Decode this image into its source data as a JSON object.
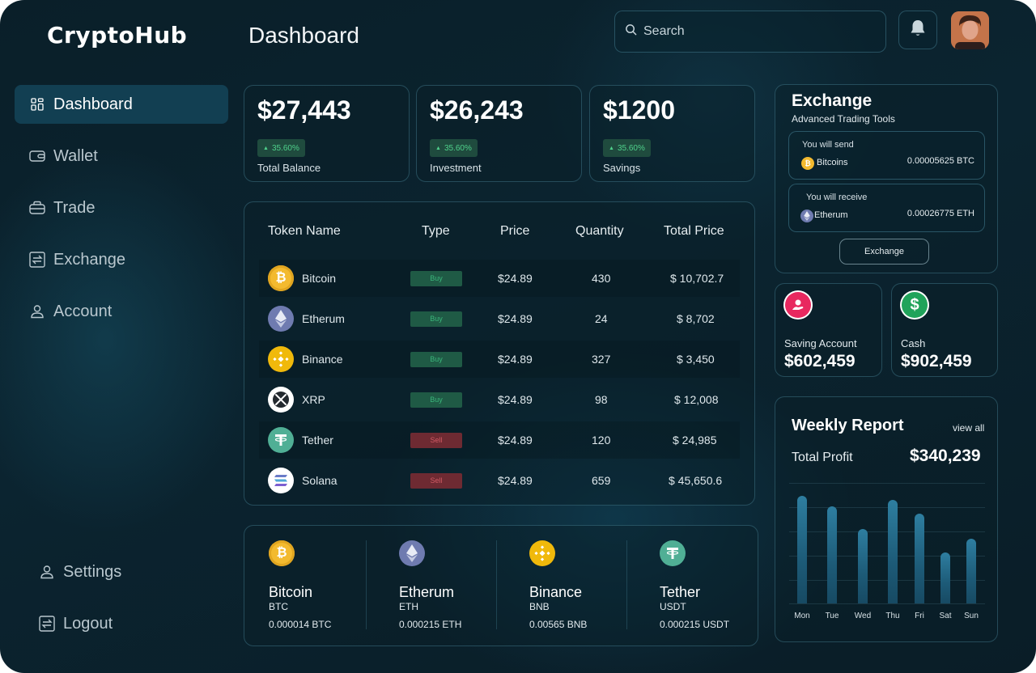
{
  "app": {
    "logo": "CryptoHub",
    "page_title": "Dashboard"
  },
  "header": {
    "search_placeholder": "Search"
  },
  "sidebar": {
    "items": [
      {
        "label": "Dashboard",
        "icon": "grid-icon",
        "active": true
      },
      {
        "label": "Wallet",
        "icon": "wallet-icon"
      },
      {
        "label": "Trade",
        "icon": "trade-icon"
      },
      {
        "label": "Exchange",
        "icon": "exchange-icon"
      },
      {
        "label": "Account",
        "icon": "user-icon"
      }
    ],
    "footer": [
      {
        "label": "Settings",
        "icon": "user-icon"
      },
      {
        "label": "Logout",
        "icon": "logout-icon"
      }
    ]
  },
  "stats": [
    {
      "value": "$27,443",
      "change": "35.60%",
      "label": "Total Balance"
    },
    {
      "value": "$26,243",
      "change": "35.60%",
      "label": "Investment"
    },
    {
      "value": "$1200",
      "change": "35.60%",
      "label": "Savings"
    }
  ],
  "table": {
    "headers": [
      "Token Name",
      "Type",
      "Price",
      "Quantity",
      "Total Price"
    ],
    "rows": [
      {
        "name": "Bitcoin",
        "type": "Buy",
        "price": "$24.89",
        "quantity": "430",
        "total": "$ 10,702.7",
        "icon": "bitcoin-icon",
        "color": "#f3ba2f"
      },
      {
        "name": "Etherum",
        "type": "Buy",
        "price": "$24.89",
        "quantity": "24",
        "total": "$ 8,702",
        "icon": "ethereum-icon",
        "color": "#8a92b2"
      },
      {
        "name": "Binance",
        "type": "Buy",
        "price": "$24.89",
        "quantity": "327",
        "total": "$ 3,450",
        "icon": "binance-icon",
        "color": "#f0b90b"
      },
      {
        "name": "XRP",
        "type": "Buy",
        "price": "$24.89",
        "quantity": "98",
        "total": "$ 12,008",
        "icon": "xrp-icon",
        "color": "#23292f"
      },
      {
        "name": "Tether",
        "type": "Sell",
        "price": "$24.89",
        "quantity": "120",
        "total": "$ 24,985",
        "icon": "tether-icon",
        "color": "#50af95"
      },
      {
        "name": "Solana",
        "type": "Sell",
        "price": "$24.89",
        "quantity": "659",
        "total": "$ 45,650.6",
        "icon": "solana-icon",
        "color": "#ffffff"
      }
    ]
  },
  "holdings": [
    {
      "name": "Bitcoin",
      "symbol": "BTC",
      "amount": "0.000014 BTC",
      "icon": "bitcoin-icon"
    },
    {
      "name": "Etherum",
      "symbol": "ETH",
      "amount": "0.000215 ETH",
      "icon": "ethereum-icon"
    },
    {
      "name": "Binance",
      "symbol": "BNB",
      "amount": "0.00565 BNB",
      "icon": "binance-icon"
    },
    {
      "name": "Tether",
      "symbol": "USDT",
      "amount": "0.000215 USDT",
      "icon": "tether-icon"
    }
  ],
  "exchange": {
    "title": "Exchange",
    "subtitle": "Advanced Trading Tools",
    "send": {
      "label": "You will send",
      "coin": "Bitcoins",
      "amount": "0.00005625 BTC"
    },
    "receive": {
      "label": "You will receive",
      "coin": "Etherum",
      "amount": "0.00026775 ETH"
    },
    "button": "Exchange"
  },
  "accounts": [
    {
      "label": "Saving Account",
      "value": "$602,459",
      "icon": "savings-icon",
      "color": "#e8285f"
    },
    {
      "label": "Cash",
      "value": "$902,459",
      "icon": "dollar-icon",
      "color": "#20a35a"
    }
  ],
  "weekly": {
    "title": "Weekly Report",
    "view_all": "view all",
    "profit_label": "Total Profit",
    "profit_value": "$340,239",
    "chart_data": {
      "type": "bar",
      "categories": [
        "Mon",
        "Tue",
        "Wed",
        "Thu",
        "Fri",
        "Sat",
        "Sun"
      ],
      "values": [
        0.91,
        0.82,
        0.63,
        0.88,
        0.76,
        0.43,
        0.55
      ]
    }
  },
  "colors": {
    "accent": "#123f52",
    "buy": "#1f5a45",
    "sell": "#6e2a32",
    "positive": "#4fd18b"
  }
}
